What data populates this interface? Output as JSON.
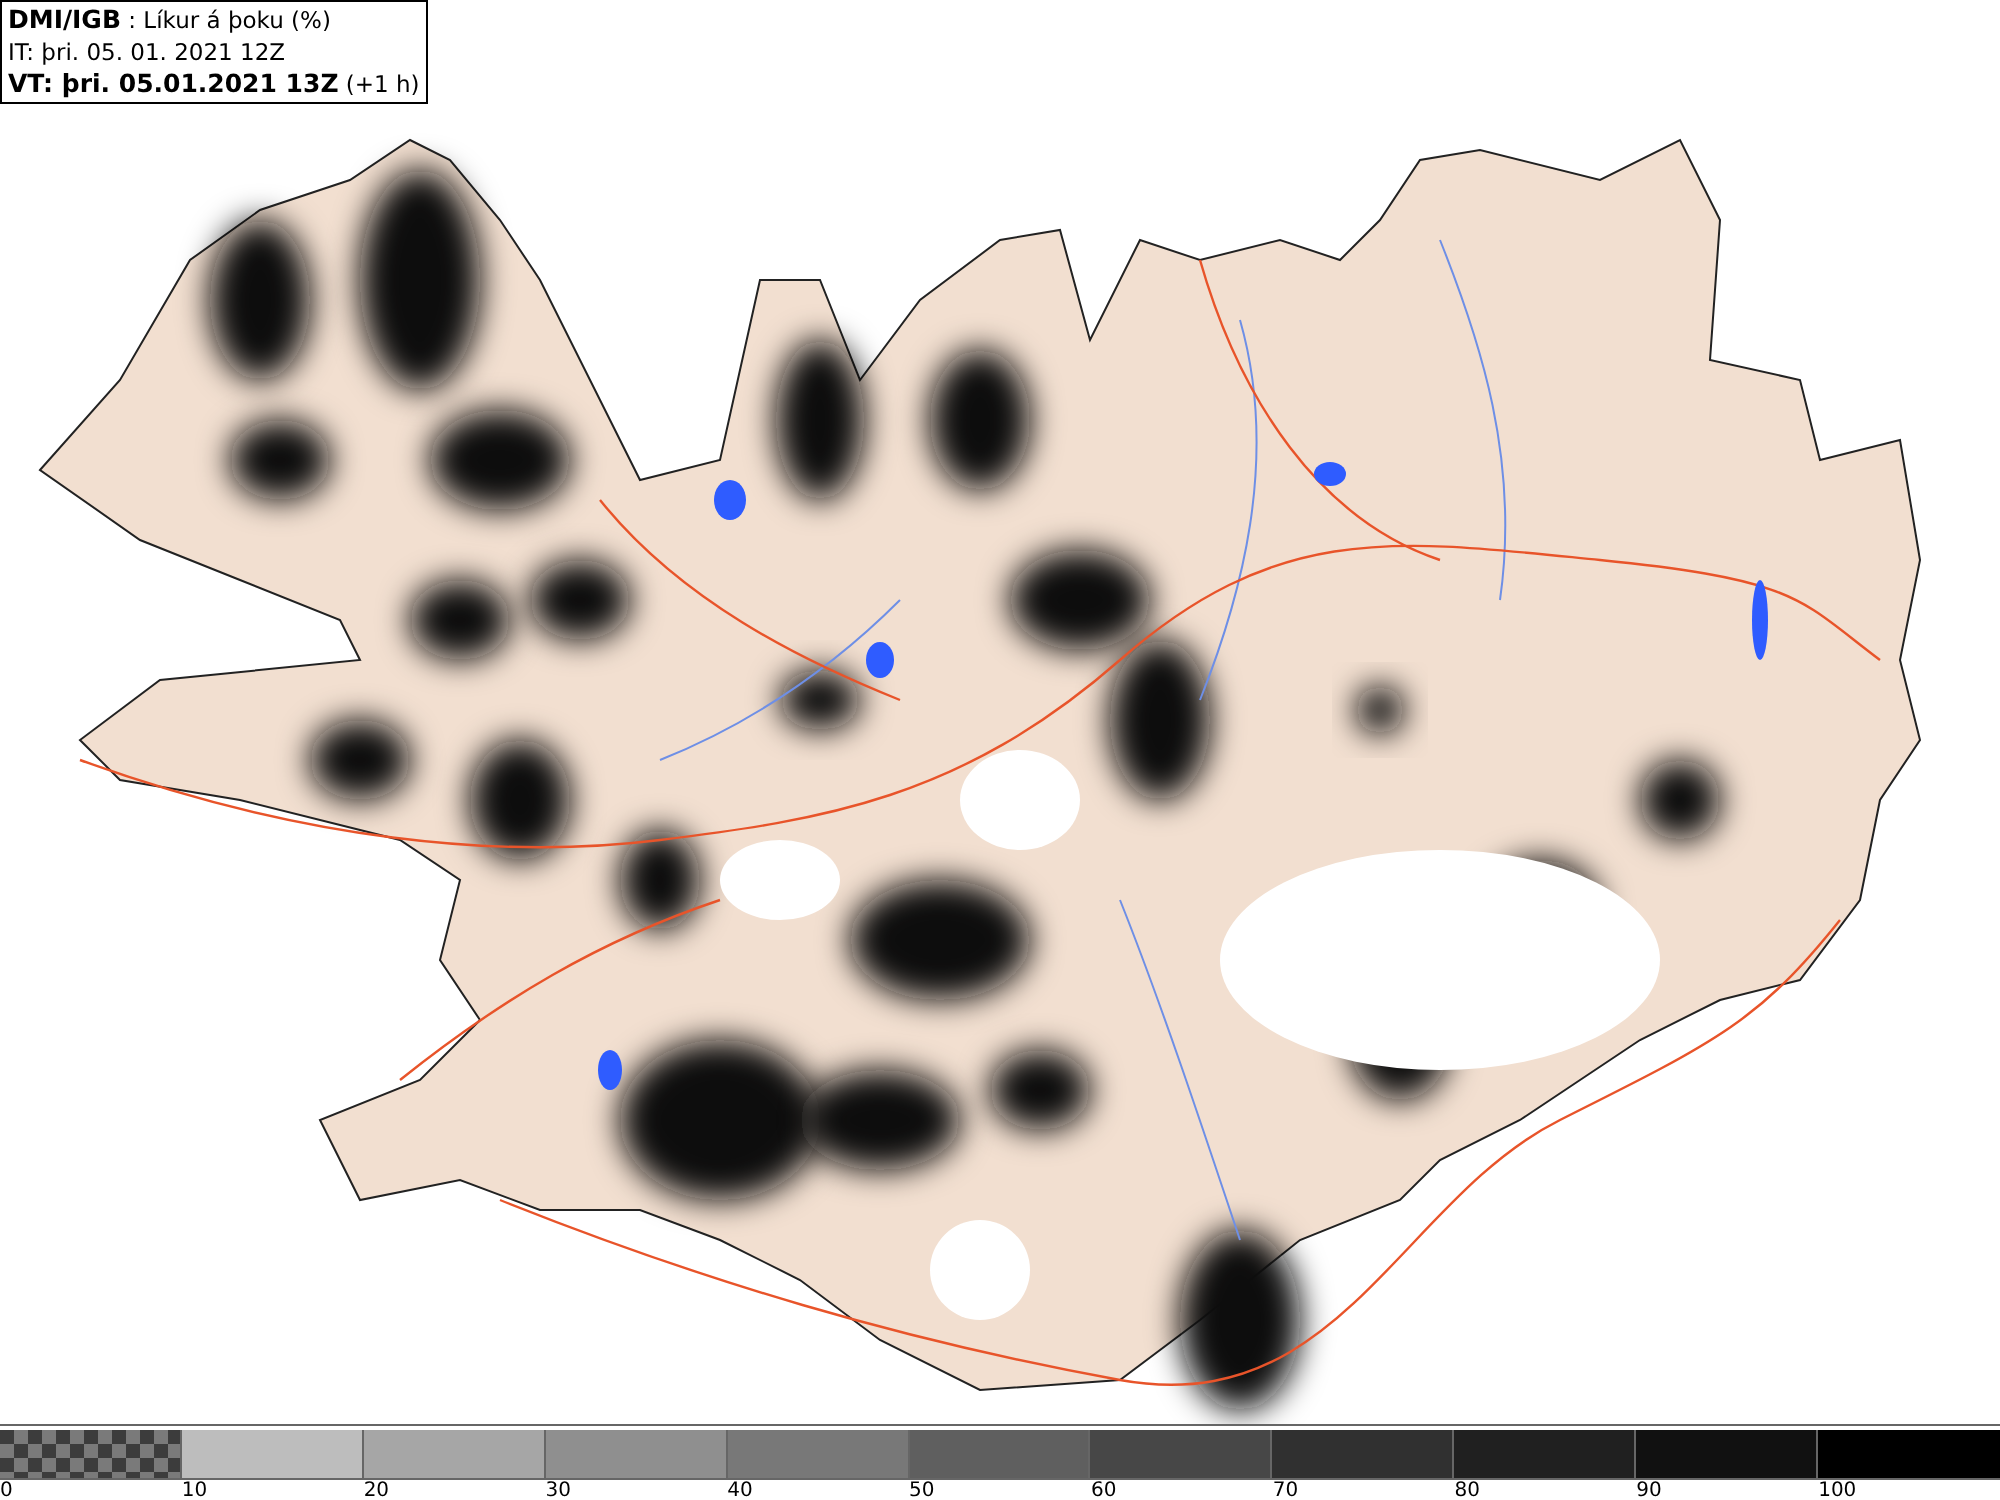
{
  "header": {
    "source": "DMI/IGB",
    "title": ": Líkur á þoku (%)",
    "init_time": "IT: þri. 05. 01. 2021 12Z",
    "valid_time": "VT: þri. 05.01.2021 13Z",
    "lead": "(+1 h)"
  },
  "legend": {
    "bins": [
      {
        "kind": "checkered",
        "color": "#7a7a7a"
      },
      {
        "kind": "solid",
        "color": "#bdbdbd"
      },
      {
        "kind": "solid",
        "color": "#a6a6a6"
      },
      {
        "kind": "solid",
        "color": "#8f8f8f"
      },
      {
        "kind": "solid",
        "color": "#787878"
      },
      {
        "kind": "solid",
        "color": "#5f5f5f"
      },
      {
        "kind": "solid",
        "color": "#474747"
      },
      {
        "kind": "solid",
        "color": "#303030"
      },
      {
        "kind": "solid",
        "color": "#202020"
      },
      {
        "kind": "solid",
        "color": "#111111"
      },
      {
        "kind": "solid",
        "color": "#000000"
      }
    ],
    "labels": [
      "0",
      "10",
      "20",
      "30",
      "40",
      "50",
      "60",
      "70",
      "80",
      "90",
      "100"
    ]
  }
}
